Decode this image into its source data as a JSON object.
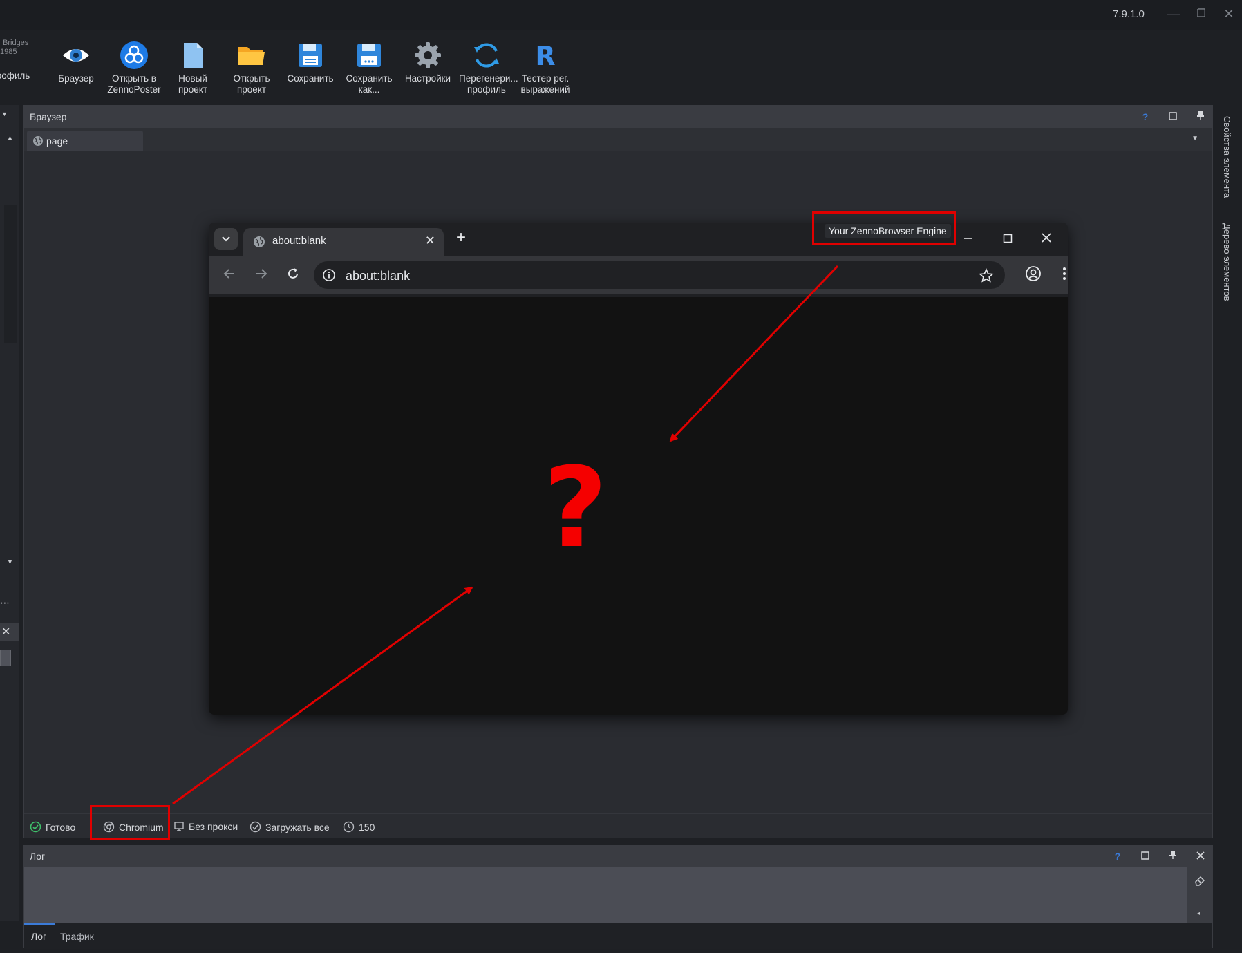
{
  "window": {
    "version": "7.9.1.0",
    "minimize_glyph": "—",
    "restore_glyph": "❐",
    "close_glyph": "✕"
  },
  "profile_mini": {
    "line1": "Bridges",
    "line2": "1985"
  },
  "toolbar": {
    "profile_partial_label": "рофиль",
    "buttons": [
      {
        "label": "Браузер",
        "icon": "eye-icon"
      },
      {
        "label": "Открыть в\nZennoPoster",
        "icon": "zennoposter-icon"
      },
      {
        "label": "Новый\nпроект",
        "icon": "new-file-icon"
      },
      {
        "label": "Открыть\nпроект",
        "icon": "folder-icon"
      },
      {
        "label": "Сохранить",
        "icon": "floppy-icon"
      },
      {
        "label": "Сохранить\nкак...",
        "icon": "floppy-as-icon"
      },
      {
        "label": "Настройки",
        "icon": "gear-icon"
      },
      {
        "label": "Перегенери...\nпрофиль",
        "icon": "regenerate-icon"
      },
      {
        "label": "Тестер рег.\nвыражений",
        "icon": "regex-icon"
      }
    ]
  },
  "right_tabs": [
    "Свойства элемента",
    "Дерево элементов"
  ],
  "browser_panel": {
    "title": "Браузер",
    "help_glyph": "?",
    "tab_label": "page"
  },
  "chrome": {
    "tab_title": "about:blank",
    "url": "about:blank"
  },
  "annotation": {
    "label": "Your ZennoBrowser Engine",
    "question_mark": "?"
  },
  "status": {
    "ready": "Готово",
    "engine": "Chromium",
    "proxy": "Без прокси",
    "load": "Загружать все",
    "timeout": "150"
  },
  "log_panel": {
    "title": "Лог",
    "help_glyph": "?",
    "tabs": [
      "Лог",
      "Трафик"
    ]
  },
  "colors": {
    "accent_red": "#e00000",
    "accent_blue": "#3b7bd8"
  }
}
